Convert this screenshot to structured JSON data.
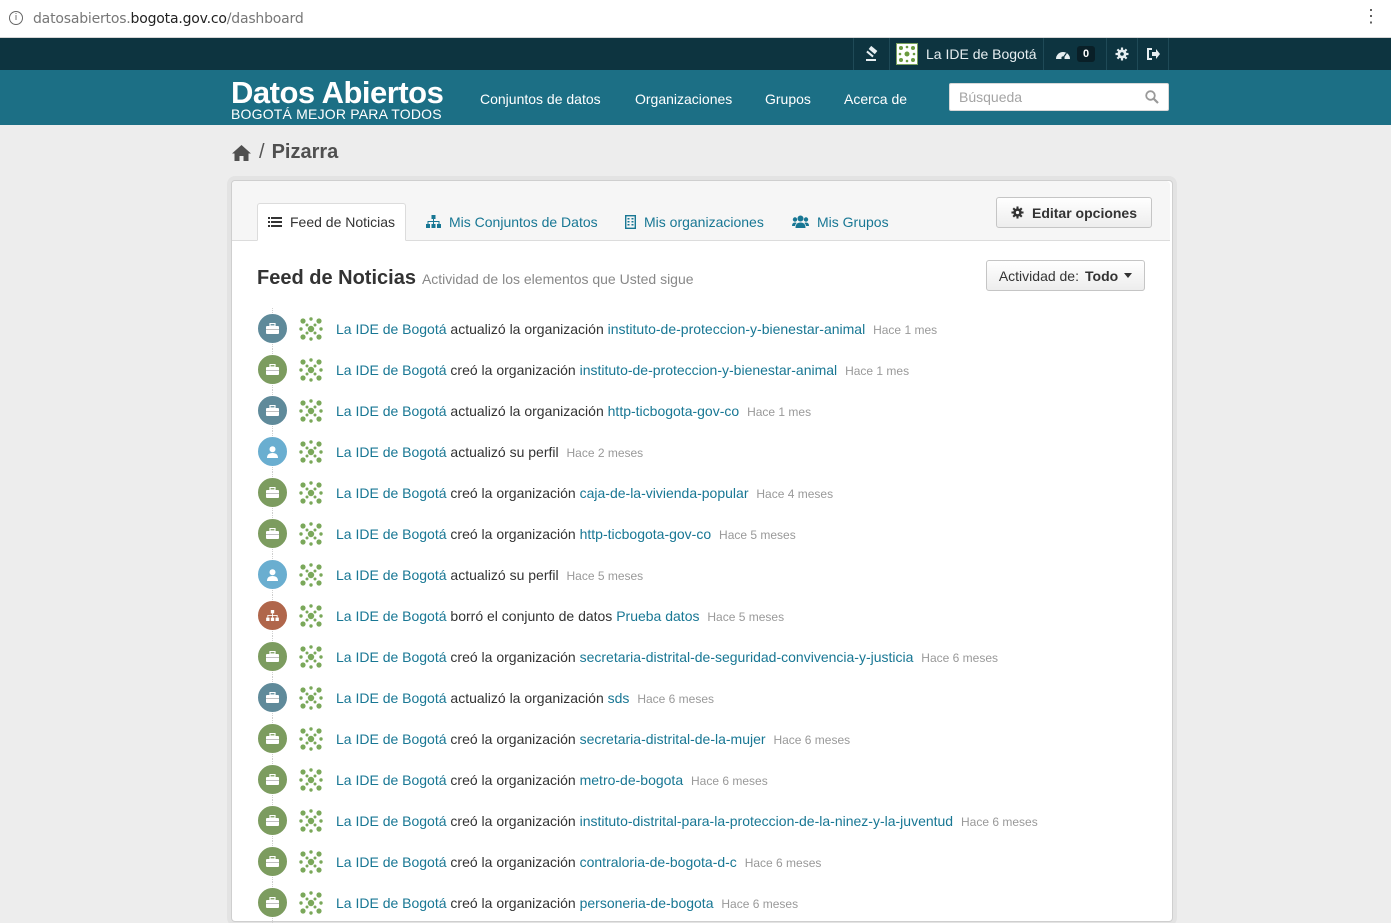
{
  "browser": {
    "url_prefix": "datosabiertos.",
    "url_host": "bogota.gov.co",
    "url_path": "/dashboard",
    "menu_glyph": "⋮"
  },
  "account": {
    "user_name": "La IDE de Bogotá",
    "notifications_count": "0"
  },
  "header": {
    "site_title": "Datos Abiertos",
    "site_subtitle": "BOGOTÁ MEJOR PARA TODOS",
    "nav": [
      "Conjuntos de datos",
      "Organizaciones",
      "Grupos",
      "Acerca de"
    ],
    "search_placeholder": "Búsqueda"
  },
  "breadcrumb": {
    "separator": "/",
    "current": "Pizarra"
  },
  "tabs": [
    {
      "label": "Feed de Noticias",
      "icon": "list-icon",
      "active": true
    },
    {
      "label": "Mis Conjuntos de Datos",
      "icon": "sitemap-icon",
      "active": false
    },
    {
      "label": "Mis organizaciones",
      "icon": "building-icon",
      "active": false
    },
    {
      "label": "Mis Grupos",
      "icon": "group-icon",
      "active": false
    }
  ],
  "edit_button_label": "Editar opciones",
  "feed": {
    "title": "Feed de Noticias",
    "subtitle": "Actividad de los elementos que Usted sigue",
    "filter_label": "Actividad de:",
    "filter_value": "Todo"
  },
  "colors": {
    "org_updated": "#5f8a9a",
    "org_created": "#7c9c5f",
    "user_updated": "#6aaed0",
    "dataset_deleted": "#b0664b",
    "link": "#187794",
    "masthead": "#1c6f85"
  },
  "activities": [
    {
      "kind": "org_updated",
      "actor": "La IDE de Bogotá",
      "action": "actualizó la organización",
      "object": "instituto-de-proteccion-y-bienestar-animal",
      "date": "Hace 1 mes"
    },
    {
      "kind": "org_created",
      "actor": "La IDE de Bogotá",
      "action": "creó la organización",
      "object": "instituto-de-proteccion-y-bienestar-animal",
      "date": "Hace 1 mes"
    },
    {
      "kind": "org_updated",
      "actor": "La IDE de Bogotá",
      "action": "actualizó la organización",
      "object": "http-ticbogota-gov-co",
      "date": "Hace 1 mes"
    },
    {
      "kind": "user_updated",
      "actor": "La IDE de Bogotá",
      "action": "actualizó su perfil",
      "object": "",
      "date": "Hace 2 meses"
    },
    {
      "kind": "org_created",
      "actor": "La IDE de Bogotá",
      "action": "creó la organización",
      "object": "caja-de-la-vivienda-popular",
      "date": "Hace 4 meses"
    },
    {
      "kind": "org_created",
      "actor": "La IDE de Bogotá",
      "action": "creó la organización",
      "object": "http-ticbogota-gov-co",
      "date": "Hace 5 meses"
    },
    {
      "kind": "user_updated",
      "actor": "La IDE de Bogotá",
      "action": "actualizó su perfil",
      "object": "",
      "date": "Hace 5 meses"
    },
    {
      "kind": "dataset_deleted",
      "actor": "La IDE de Bogotá",
      "action": "borró el conjunto de datos",
      "object": "Prueba datos",
      "date": "Hace 5 meses"
    },
    {
      "kind": "org_created",
      "actor": "La IDE de Bogotá",
      "action": "creó la organización",
      "object": "secretaria-distrital-de-seguridad-convivencia-y-justicia",
      "date": "Hace 6 meses"
    },
    {
      "kind": "org_updated",
      "actor": "La IDE de Bogotá",
      "action": "actualizó la organización",
      "object": "sds",
      "date": "Hace 6 meses"
    },
    {
      "kind": "org_created",
      "actor": "La IDE de Bogotá",
      "action": "creó la organización",
      "object": "secretaria-distrital-de-la-mujer",
      "date": "Hace 6 meses"
    },
    {
      "kind": "org_created",
      "actor": "La IDE de Bogotá",
      "action": "creó la organización",
      "object": "metro-de-bogota",
      "date": "Hace 6 meses"
    },
    {
      "kind": "org_created",
      "actor": "La IDE de Bogotá",
      "action": "creó la organización",
      "object": "instituto-distrital-para-la-proteccion-de-la-ninez-y-la-juventud",
      "date": "Hace 6 meses"
    },
    {
      "kind": "org_created",
      "actor": "La IDE de Bogotá",
      "action": "creó la organización",
      "object": "contraloria-de-bogota-d-c",
      "date": "Hace 6 meses"
    },
    {
      "kind": "org_created",
      "actor": "La IDE de Bogotá",
      "action": "creó la organización",
      "object": "personeria-de-bogota",
      "date": "Hace 6 meses"
    }
  ]
}
